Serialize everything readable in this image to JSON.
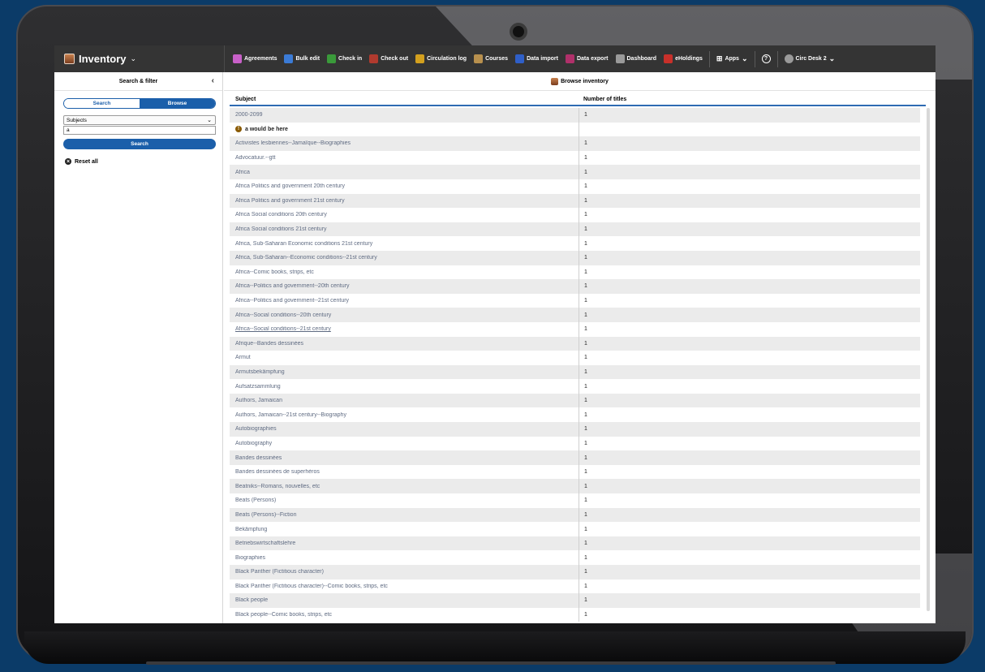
{
  "app": {
    "title": "Inventory"
  },
  "nav": [
    {
      "label": "Agreements",
      "icon": "agreements-icon",
      "color": "#c860c8"
    },
    {
      "label": "Bulk edit",
      "icon": "bulk-edit-icon",
      "color": "#3b7bd6"
    },
    {
      "label": "Check in",
      "icon": "check-in-icon",
      "color": "#3a9a3a"
    },
    {
      "label": "Check out",
      "icon": "check-out-icon",
      "color": "#b03a2e"
    },
    {
      "label": "Circulation log",
      "icon": "circulation-log-icon",
      "color": "#d3a01e"
    },
    {
      "label": "Courses",
      "icon": "courses-icon",
      "color": "#b8904e"
    },
    {
      "label": "Data import",
      "icon": "data-import-icon",
      "color": "#2f5fc8"
    },
    {
      "label": "Data export",
      "icon": "data-export-icon",
      "color": "#b0306a"
    },
    {
      "label": "Dashboard",
      "icon": "dashboard-icon",
      "color": "#9a9a9a"
    },
    {
      "label": "eHoldings",
      "icon": "eholdings-icon",
      "color": "#c8302a"
    }
  ],
  "nav_right": {
    "apps": "Apps",
    "help": "?",
    "user": "Circ Desk 2"
  },
  "filter": {
    "title": "Search & filter",
    "tab_search": "Search",
    "tab_browse": "Browse",
    "browse_option": "Subjects",
    "query": "a",
    "search_button": "Search",
    "reset": "Reset all"
  },
  "results": {
    "title": "Browse inventory",
    "col_subject": "Subject",
    "col_count": "Number of titles",
    "placeholder_text": "a would be here",
    "rows": [
      {
        "subject": "2000-2099",
        "count": "1"
      },
      {
        "subject": "",
        "count": "",
        "placeholder": true
      },
      {
        "subject": "Activistes lesbiennes--Jamaïque--Biographies",
        "count": "1"
      },
      {
        "subject": "Advocatuur.--gtt",
        "count": "1"
      },
      {
        "subject": "Africa",
        "count": "1"
      },
      {
        "subject": "Africa Politics and government 20th century",
        "count": "1"
      },
      {
        "subject": "Africa Politics and government 21st century",
        "count": "1"
      },
      {
        "subject": "Africa Social conditions 20th century",
        "count": "1"
      },
      {
        "subject": "Africa Social conditions 21st century",
        "count": "1"
      },
      {
        "subject": "Africa, Sub-Saharan Economic conditions 21st century",
        "count": "1"
      },
      {
        "subject": "Africa, Sub-Saharan--Economic conditions--21st century",
        "count": "1"
      },
      {
        "subject": "Africa--Comic books, strips, etc",
        "count": "1"
      },
      {
        "subject": "Africa--Politics and government--20th century",
        "count": "1"
      },
      {
        "subject": "Africa--Politics and government--21st century",
        "count": "1"
      },
      {
        "subject": "Africa--Social conditions--20th century",
        "count": "1"
      },
      {
        "subject": "Africa--Social conditions--21st century",
        "count": "1",
        "selected": true
      },
      {
        "subject": "Afrique--Bandes dessinées",
        "count": "1"
      },
      {
        "subject": "Armut",
        "count": "1"
      },
      {
        "subject": "Armutsbekämpfung",
        "count": "1"
      },
      {
        "subject": "Aufsatzsammlung",
        "count": "1"
      },
      {
        "subject": "Authors, Jamaican",
        "count": "1"
      },
      {
        "subject": "Authors, Jamaican--21st century--Biography",
        "count": "1"
      },
      {
        "subject": "Autobiographies",
        "count": "1"
      },
      {
        "subject": "Autobiography",
        "count": "1"
      },
      {
        "subject": "Bandes dessinées",
        "count": "1"
      },
      {
        "subject": "Bandes dessinées de superhéros",
        "count": "1"
      },
      {
        "subject": "Beatniks--Romans, nouvelles, etc",
        "count": "1"
      },
      {
        "subject": "Beats (Persons)",
        "count": "1"
      },
      {
        "subject": "Beats (Persons)--Fiction",
        "count": "1"
      },
      {
        "subject": "Bekämpfung",
        "count": "1"
      },
      {
        "subject": "Betriebswirtschaftslehre",
        "count": "1"
      },
      {
        "subject": "Biographies",
        "count": "1"
      },
      {
        "subject": "Black Panther (Fictitious character)",
        "count": "1"
      },
      {
        "subject": "Black Panther (Fictitious character)--Comic books, strips, etc",
        "count": "1"
      },
      {
        "subject": "Black people",
        "count": "1"
      },
      {
        "subject": "Black people--Comic books, strips, etc",
        "count": "1"
      }
    ]
  }
}
